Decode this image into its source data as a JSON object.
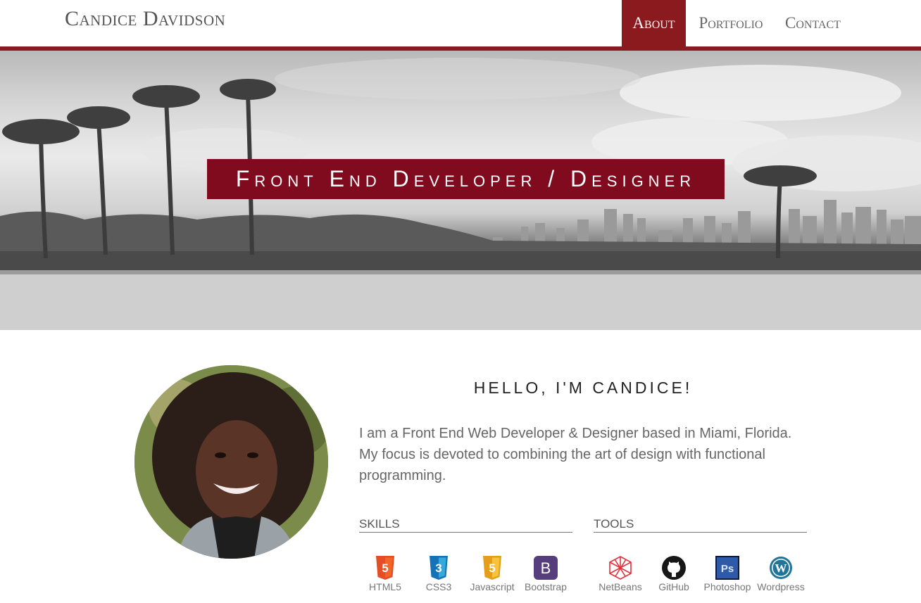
{
  "header": {
    "brand": "Candice Davidson",
    "nav": [
      {
        "label": "About",
        "active": true
      },
      {
        "label": "Portfolio",
        "active": false
      },
      {
        "label": "Contact",
        "active": false
      }
    ]
  },
  "hero": {
    "title": "Front End Developer / Designer"
  },
  "about": {
    "greeting": "HELLO, I'M CANDICE!",
    "bio": "I am a Front End Web Developer & Designer based in Miami, Florida. My focus is devoted to combining the art of design with functional programming.",
    "skills_heading": "SKILLS",
    "tools_heading": "TOOLS",
    "skills": [
      {
        "label": "HTML5",
        "icon": "html5-icon",
        "color": "#e44d26"
      },
      {
        "label": "CSS3",
        "icon": "css3-icon",
        "color": "#2965f1"
      },
      {
        "label": "Javascript",
        "icon": "javascript-icon",
        "color": "#f0a41c"
      },
      {
        "label": "Bootstrap",
        "icon": "bootstrap-icon",
        "color": "#563d7c"
      }
    ],
    "tools": [
      {
        "label": "NetBeans",
        "icon": "netbeans-icon",
        "color": "#e0323c"
      },
      {
        "label": "GitHub",
        "icon": "github-icon",
        "color": "#181717"
      },
      {
        "label": "Photoshop",
        "icon": "photoshop-icon",
        "color": "#2c3f7f"
      },
      {
        "label": "Wordpress",
        "icon": "wordpress-icon",
        "color": "#21759b"
      }
    ]
  },
  "colors": {
    "accent": "#8b1a1f",
    "hero_title_bg": "#800a1e"
  }
}
